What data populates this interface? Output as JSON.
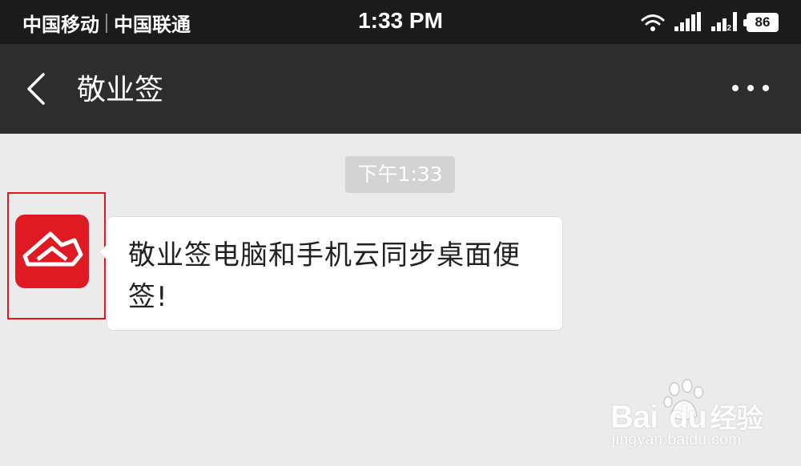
{
  "status_bar": {
    "carrier_1": "中国移动",
    "carrier_2": "中国联通",
    "time": "1:33 PM",
    "signal_2_sub": "2",
    "battery": "86"
  },
  "nav": {
    "title": "敬业签",
    "back_icon": "chevron-left-icon",
    "more_icon": "more-horizontal-icon"
  },
  "chat": {
    "timestamp": "下午1:33",
    "message_text": "敬业签电脑和手机云同步桌面便签!"
  },
  "watermark": {
    "logo_latin_1": "Bai",
    "logo_latin_2": "du",
    "logo_cjk": "经验",
    "url": "jingyan.baidu.com"
  },
  "colors": {
    "status_bar_bg": "#1b1b1b",
    "nav_bg": "#2d2d2d",
    "chat_bg": "#ebebeb",
    "avatar_red": "#e01a22",
    "highlight_red": "#e0181e"
  }
}
